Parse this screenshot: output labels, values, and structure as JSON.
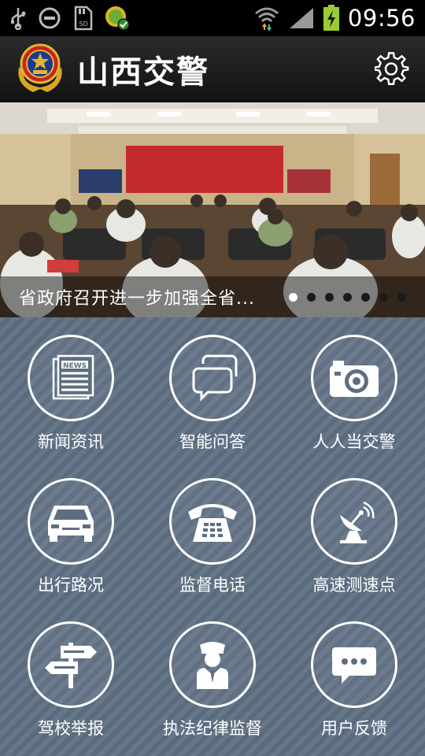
{
  "status_bar": {
    "time": "09:56",
    "left_icons": [
      "usb-icon",
      "do-not-disturb-icon",
      "sd-card-icon",
      "app-notification-icon"
    ],
    "right_icons": [
      "wifi-icon",
      "signal-icon",
      "battery-charging-icon"
    ]
  },
  "header": {
    "title": "山西交警",
    "logo_icon": "police-emblem-icon",
    "settings_icon": "gear-icon"
  },
  "banner": {
    "caption": "省政府召开进一步加强全省...",
    "slide_count": 7,
    "active_slide": 1
  },
  "menu": [
    {
      "label": "新闻资讯",
      "icon": "newspaper-icon"
    },
    {
      "label": "智能问答",
      "icon": "chat-bubbles-icon"
    },
    {
      "label": "人人当交警",
      "icon": "camera-icon"
    },
    {
      "label": "出行路况",
      "icon": "car-icon"
    },
    {
      "label": "监督电话",
      "icon": "telephone-icon"
    },
    {
      "label": "高速测速点",
      "icon": "satellite-dish-icon"
    },
    {
      "label": "驾校举报",
      "icon": "signpost-icon"
    },
    {
      "label": "执法纪律监督",
      "icon": "police-officer-icon"
    },
    {
      "label": "用户反馈",
      "icon": "speech-bubble-icon"
    }
  ]
}
